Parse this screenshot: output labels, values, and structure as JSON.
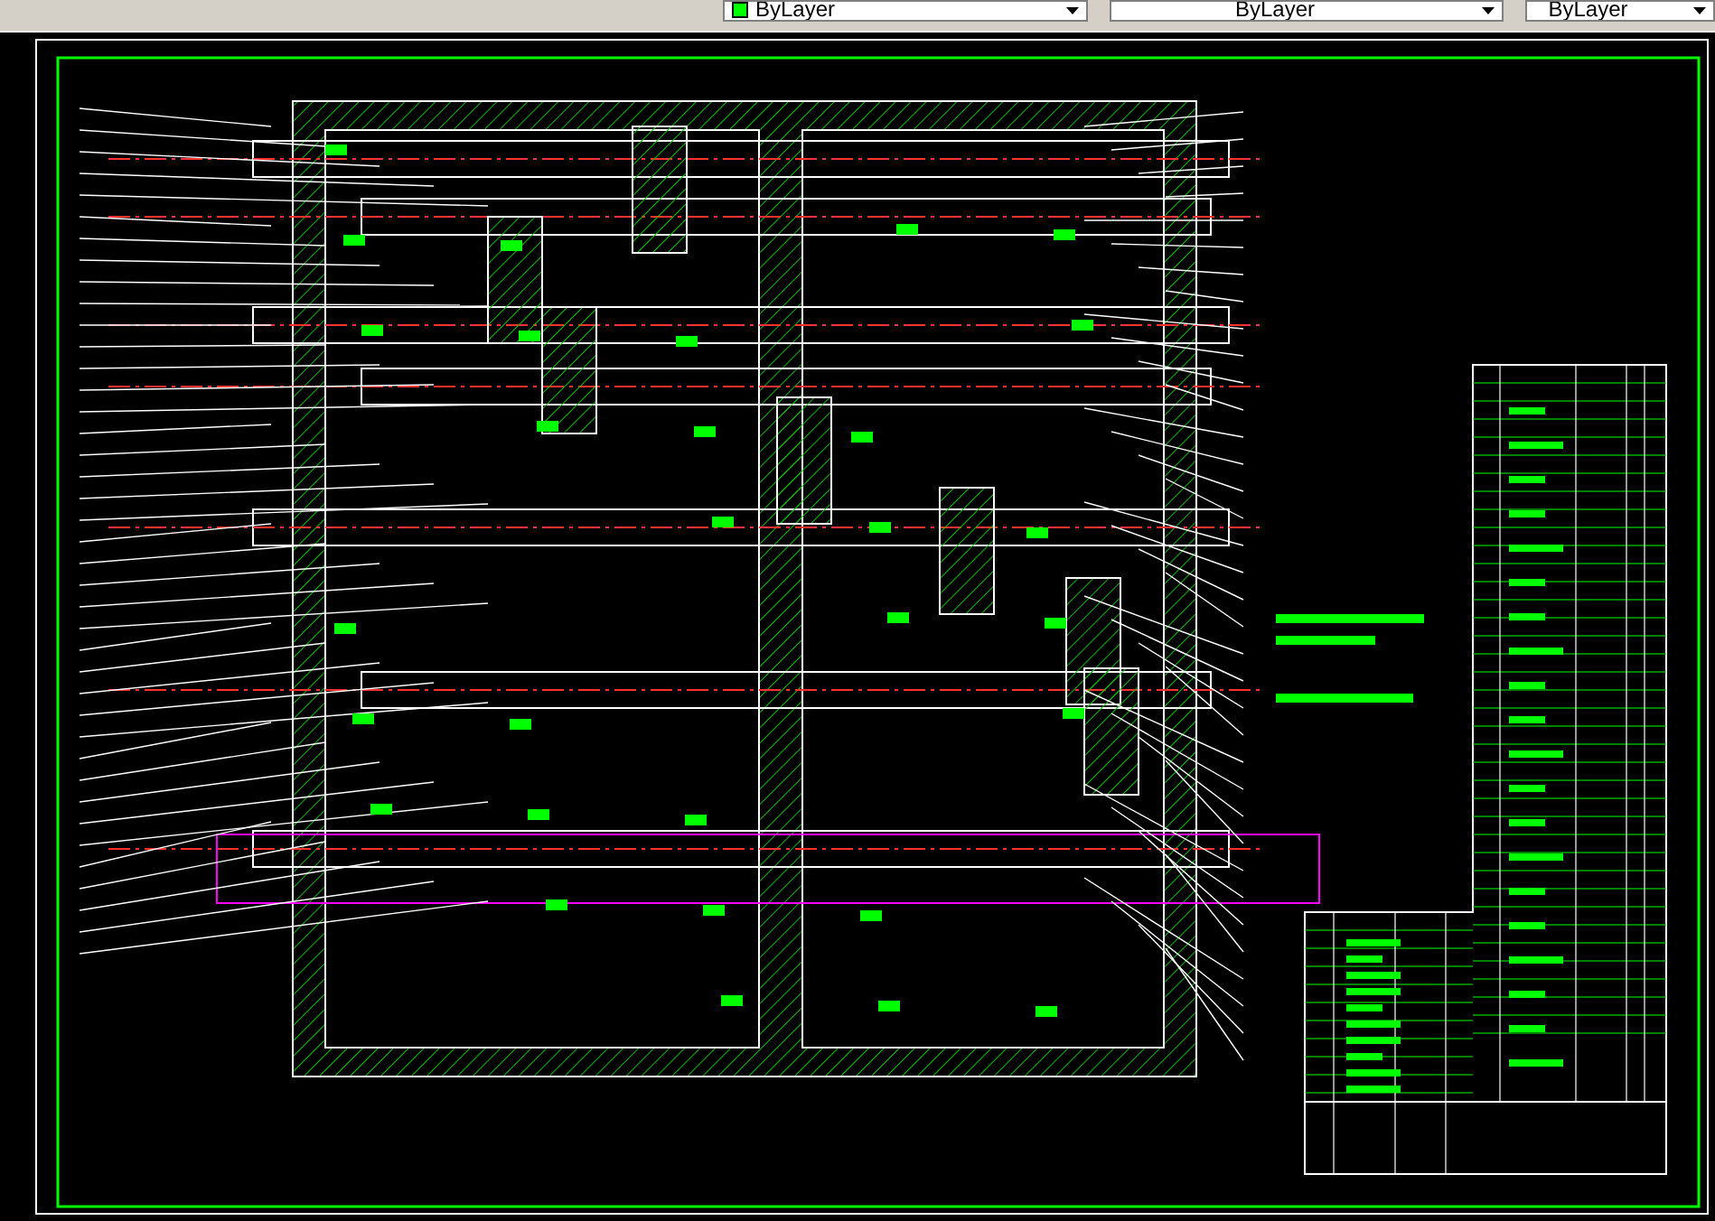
{
  "toolbar": {
    "combos": [
      {
        "label": "ByLayer",
        "swatch": true
      },
      {
        "label": "ByLayer",
        "swatch": false
      },
      {
        "label": "ByLayer",
        "swatch": false
      }
    ]
  }
}
